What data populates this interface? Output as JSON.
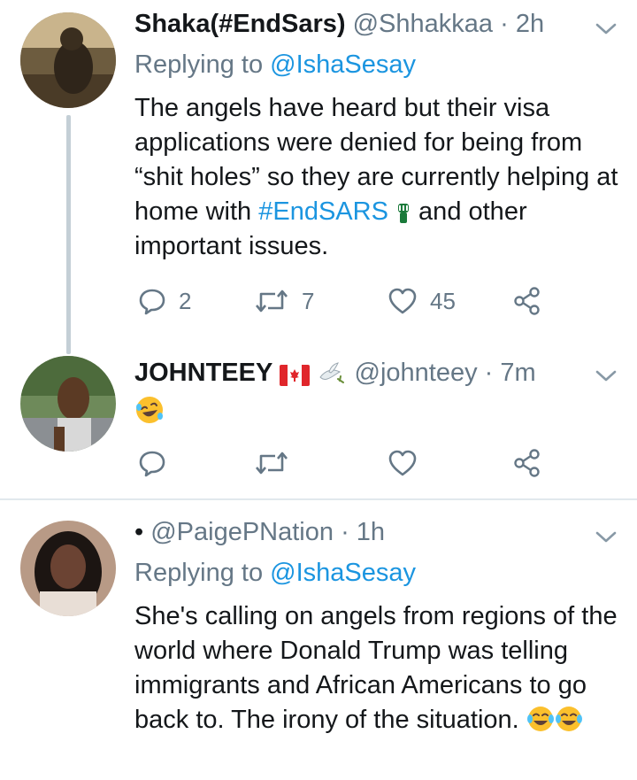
{
  "tweets": [
    {
      "name": "Shaka(#EndSars)",
      "handle": "@Shhakkaa",
      "sep": "·",
      "time": "2h",
      "replying_prefix": "Replying to",
      "replying_handle": "@IshaSesay",
      "text_before": "The angels have heard but their visa applications were denied for being from “shit holes” so they are currently helping at home with ",
      "hashtag": "#EndSARS",
      "text_after": " and other important issues.",
      "reply_count": "2",
      "retweet_count": "7",
      "like_count": "45"
    },
    {
      "name": "JOHNTEEY",
      "handle": "@johnteey",
      "sep": "·",
      "time": "7m",
      "reply_count": "",
      "retweet_count": "",
      "like_count": ""
    },
    {
      "name": "•",
      "handle": "@PaigePNation",
      "sep": "·",
      "time": "1h",
      "replying_prefix": "Replying to",
      "replying_handle": "@IshaSesay",
      "text": "She's calling on angels from regions of the world where Donald Trump was telling immigrants and African Americans to go back to. The irony of the situation."
    }
  ],
  "colors": {
    "link": "#1b95e0",
    "muted": "#657786",
    "text": "#14171a",
    "divider": "#e1e8ed"
  },
  "icons": [
    "reply-icon",
    "retweet-icon",
    "like-icon",
    "share-icon",
    "chevron-down-icon",
    "canada-flag-icon",
    "dove-icon",
    "raised-fist-icon",
    "laughing-emoji-icon"
  ]
}
